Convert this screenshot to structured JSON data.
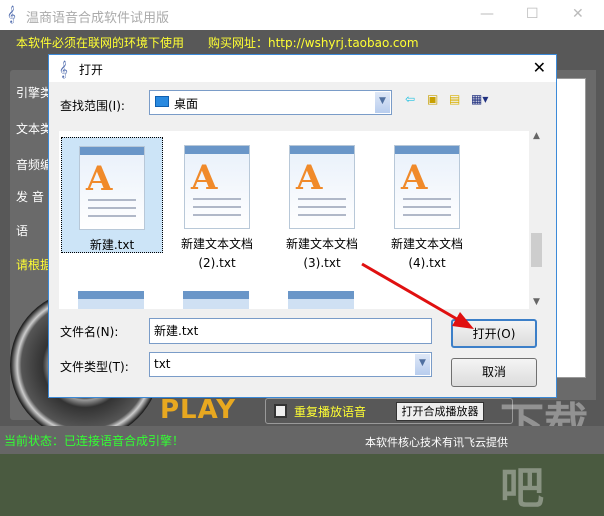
{
  "app": {
    "title": "温商语音合成软件试用版",
    "notice": "本软件必须在联网的环境下使用",
    "buy": "购买网址：http://wshyrj.taobao.com",
    "left_labels": [
      "引擎类",
      "文本类",
      "音频编",
      "发 音",
      "语",
      "请根据"
    ],
    "play": "PLAY",
    "repeat_label": "重复播放语音",
    "open_player": "打开合成播放器",
    "status": "当前状态：已连接语音合成引擎！",
    "credit": "本软件核心技术有讯飞云提供",
    "watermark": "下载吧"
  },
  "dialog": {
    "title": "打开",
    "look_in_label": "查找范围(I):",
    "look_in_value": "桌面",
    "files": [
      {
        "name": "新建.txt",
        "selected": true
      },
      {
        "name": "新建文本文档\n(2).txt"
      },
      {
        "name": "新建文本文档\n(3).txt"
      },
      {
        "name": "新建文本文档\n(4).txt"
      }
    ],
    "filename_label": "文件名(N):",
    "filename_value": "新建.txt",
    "filetype_label": "文件类型(T):",
    "filetype_value": "txt",
    "open_button": "打开(O)",
    "cancel_button": "取消"
  },
  "colors": {
    "accent": "#3c8ad8",
    "notice": "#ffff33",
    "status": "#33ff33",
    "annotation_arrow": "#e01010"
  }
}
